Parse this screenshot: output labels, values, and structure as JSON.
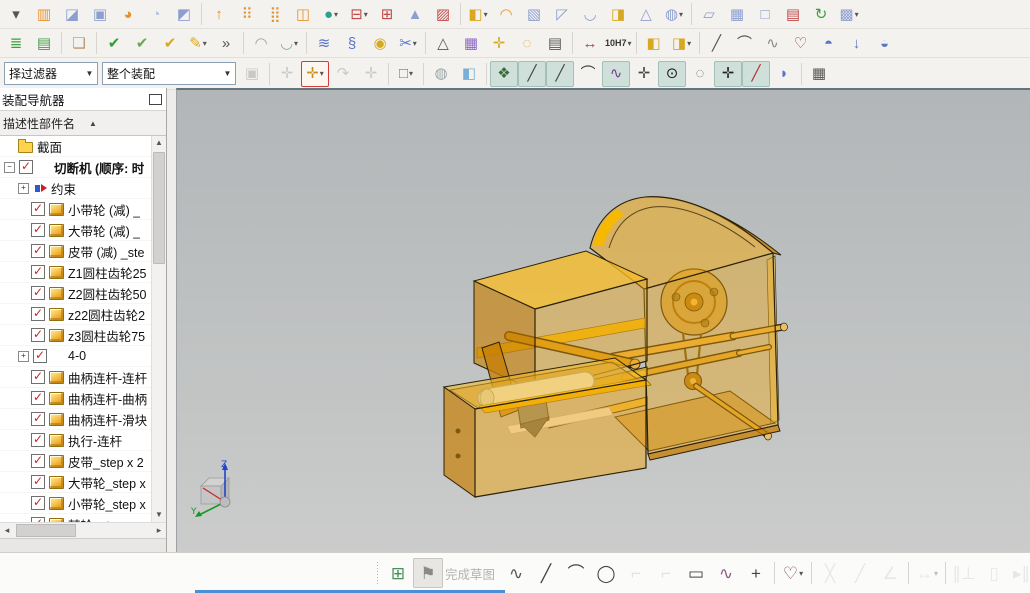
{
  "colors": {
    "check_red": "#cc1f1f",
    "accent_blue": "#4a90d9",
    "viewport_top": "#b2b6b8",
    "viewport_bottom": "#cbcccb",
    "model_edge": "#2c2208",
    "model_bright_yellow": "#f6b900"
  },
  "toolbar_row1": {
    "items": [
      {
        "name": "feature-overflow-icon",
        "glyph": "▾",
        "color": "#555555"
      },
      {
        "name": "split-body-icon",
        "glyph": "▥",
        "color": "#e8922c"
      },
      {
        "name": "trim-body-icon",
        "glyph": "◪",
        "color": "#8d9fd0"
      },
      {
        "name": "hole-icon",
        "glyph": "▣",
        "color": "#8d9fd0"
      },
      {
        "name": "boss-icon",
        "glyph": "◕",
        "color": "#e8922c"
      },
      {
        "name": "groove-icon",
        "glyph": "◔",
        "color": "#b4c0dc"
      },
      {
        "name": "pocket-icon",
        "glyph": "◩",
        "color": "#8d9fd0"
      },
      {
        "sep": true
      },
      {
        "name": "extract-body-icon",
        "glyph": "↑",
        "color": "#e8922c"
      },
      {
        "name": "pattern-feature-icon",
        "glyph": "⠿",
        "color": "#e8922c"
      },
      {
        "name": "pattern-geometry-icon",
        "glyph": "⣿",
        "color": "#e8922c"
      },
      {
        "name": "mirror-feature-icon",
        "glyph": "◫",
        "color": "#e8922c"
      },
      {
        "name": "unite-icon",
        "glyph": "●",
        "color": "#2e9e8f",
        "dd": true
      },
      {
        "name": "subtract-icon",
        "glyph": "⊟",
        "color": "#c04848",
        "dd": true
      },
      {
        "name": "intersect-icon",
        "glyph": "⊞",
        "color": "#c04848"
      },
      {
        "name": "emboss-icon",
        "glyph": "▲",
        "color": "#8d9fd0"
      },
      {
        "name": "offset-face-icon",
        "glyph": "▨",
        "color": "#c04848"
      },
      {
        "sep": true
      },
      {
        "name": "shell-icon",
        "glyph": "◧",
        "color": "#d8a820",
        "dd": true
      },
      {
        "name": "wrap-icon",
        "glyph": "◠",
        "color": "#e8922c"
      },
      {
        "name": "edge-blend-icon",
        "glyph": "▧",
        "color": "#8d9fd0"
      },
      {
        "name": "chamfer-icon",
        "glyph": "◸",
        "color": "#8d9fd0"
      },
      {
        "name": "flange-icon",
        "glyph": "◡",
        "color": "#8d9fd0"
      },
      {
        "name": "draft-icon",
        "glyph": "◨",
        "color": "#d8a820"
      },
      {
        "name": "scale-body-icon",
        "glyph": "△",
        "color": "#8d9fd0"
      },
      {
        "name": "sphere-icon",
        "glyph": "◍",
        "color": "#8d9fd0",
        "dd": true
      },
      {
        "sep": true
      },
      {
        "name": "four-point-surface-icon",
        "glyph": "▱",
        "color": "#8d9fd0"
      },
      {
        "name": "mesh-surface-icon",
        "glyph": "▦",
        "color": "#8d9fd0"
      },
      {
        "name": "bounded-plane-icon",
        "glyph": "□",
        "color": "#8d9fd0"
      },
      {
        "name": "through-curves-icon",
        "glyph": "▤",
        "color": "#c04848"
      },
      {
        "name": "swept-icon",
        "glyph": "↻",
        "color": "#3d9e3d"
      },
      {
        "name": "sew-icon",
        "glyph": "▩",
        "color": "#8d9fd0",
        "dd": true
      }
    ]
  },
  "toolbar_row2": {
    "items": [
      {
        "name": "layer-settings-icon",
        "glyph": "≣",
        "color": "#3d9e3d"
      },
      {
        "name": "layer-category-icon",
        "glyph": "▤",
        "color": "#3d9e3d"
      },
      {
        "sep": true
      },
      {
        "name": "tag-note-icon",
        "glyph": "❏",
        "color": "#b49a6a"
      },
      {
        "sep": true
      },
      {
        "name": "examine-geometry-icon",
        "glyph": "✔",
        "color": "#2da02d"
      },
      {
        "name": "fit-check-icon",
        "glyph": "✔",
        "color": "#6aa84f"
      },
      {
        "name": "check-body-icon",
        "glyph": "✔",
        "color": "#d8a820"
      },
      {
        "name": "edit-object-display-icon",
        "glyph": "✎",
        "color": "#d8a820",
        "dd": true
      },
      {
        "name": "toolbar-overflow-chevron",
        "glyph": "»",
        "color": "#555555"
      },
      {
        "sep": true
      },
      {
        "name": "weld-assistant-icon",
        "glyph": "◠",
        "color": "#98a4a8"
      },
      {
        "name": "weld-groove-icon",
        "glyph": "◡",
        "color": "#98a4a8",
        "dd": true
      },
      {
        "sep": true
      },
      {
        "name": "coil-spring-icon",
        "glyph": "≋",
        "color": "#5a74c8"
      },
      {
        "name": "extension-spring-icon",
        "glyph": "§",
        "color": "#5a74c8"
      },
      {
        "name": "pulley-icon",
        "glyph": "◉",
        "color": "#d8a820"
      },
      {
        "name": "spring-tool-icon",
        "glyph": "✂",
        "color": "#5a74c8",
        "dd": true
      },
      {
        "sep": true
      },
      {
        "name": "triangle-symbol-icon",
        "glyph": "△",
        "color": "#555555"
      },
      {
        "name": "gc-toolbox-table-icon",
        "glyph": "▦",
        "color": "#8a6ac0"
      },
      {
        "name": "point-set-folder-icon",
        "glyph": "✛",
        "color": "#d8a820"
      },
      {
        "name": "circle-set-folder-icon",
        "glyph": "◌",
        "color": "#d8a820"
      },
      {
        "name": "notes-document-icon",
        "glyph": "▤",
        "color": "#555555"
      },
      {
        "sep": true
      },
      {
        "name": "measure-distance-icon",
        "glyph": "↔",
        "color": "#a04848"
      },
      {
        "name": "tolerance-search-icon",
        "label": "10H7",
        "color": "#333333",
        "dd": true
      },
      {
        "sep": true
      },
      {
        "name": "locked-component-icon",
        "glyph": "◧",
        "color": "#d8a820"
      },
      {
        "name": "locked-assembly-icon",
        "glyph": "◨",
        "color": "#d8a820",
        "dd": true
      },
      {
        "sep": true
      },
      {
        "name": "line-curve-icon",
        "glyph": "╱",
        "color": "#555555"
      },
      {
        "name": "arc-curve-icon",
        "glyph": "⌒",
        "color": "#555555"
      },
      {
        "name": "polyline-curve-icon",
        "glyph": "∿",
        "color": "#888888"
      },
      {
        "name": "studio-spline-icon",
        "glyph": "♡",
        "color": "#a03030"
      },
      {
        "name": "section-surface-icon",
        "glyph": "◓",
        "color": "#5a74c8"
      },
      {
        "name": "project-curve-icon",
        "glyph": "↓",
        "color": "#5a74c8"
      },
      {
        "name": "trim-sheet-icon",
        "glyph": "◒",
        "color": "#5a74c8"
      }
    ]
  },
  "selection_bar": {
    "filter_combo": "择过滤器",
    "scope_combo": "整个装配",
    "items": [
      {
        "name": "assembly-search-icon",
        "glyph": "▣",
        "color": "#888888",
        "disabled": true
      },
      {
        "sep": true
      },
      {
        "name": "move-component-icon",
        "glyph": "✛",
        "color": "#888888",
        "disabled": true
      },
      {
        "name": "snap-filter-icon",
        "glyph": "✛",
        "color": "#c79010",
        "redbox": true,
        "dd": true
      },
      {
        "name": "rotate-view-icon",
        "glyph": "↷",
        "color": "#888888",
        "disabled": true
      },
      {
        "name": "show-handles-icon",
        "glyph": "✛",
        "color": "#888888",
        "disabled": true
      },
      {
        "sep": true
      },
      {
        "name": "rectangle-select-icon",
        "glyph": "□",
        "color": "#777777",
        "dashed": true,
        "dd": true
      },
      {
        "sep": true
      },
      {
        "name": "shaded-cylinder-icon",
        "glyph": "◍",
        "color": "#98a4a8"
      },
      {
        "name": "translucent-box-icon",
        "glyph": "◧",
        "color": "#7ab0d8"
      },
      {
        "sep": true
      },
      {
        "name": "snap-point-icon",
        "glyph": "❖",
        "color": "#3a6a3a",
        "on": true
      },
      {
        "name": "snap-endpoint-icon",
        "glyph": "╱",
        "color": "#444444",
        "on": true
      },
      {
        "name": "snap-midpoint-icon",
        "glyph": "╱",
        "color": "#444444",
        "on": true
      },
      {
        "name": "snap-control-point-icon",
        "glyph": "⌒",
        "color": "#444444"
      },
      {
        "name": "snap-node-icon",
        "glyph": "∿",
        "color": "#7a3a8a",
        "on": true
      },
      {
        "name": "snap-quadrant-icon",
        "glyph": "✛",
        "color": "#444444"
      },
      {
        "name": "snap-arc-center-icon",
        "glyph": "⊙",
        "color": "#222222",
        "on": true
      },
      {
        "name": "snap-circle-icon",
        "glyph": "◌",
        "color": "#666666"
      },
      {
        "name": "snap-intersection-icon",
        "glyph": "✛",
        "color": "#222222",
        "on": true
      },
      {
        "name": "snap-point-on-curve-icon",
        "glyph": "╱",
        "color": "#b03030",
        "on": true
      },
      {
        "name": "snap-point-on-face-icon",
        "glyph": "◗",
        "color": "#5a74c8"
      },
      {
        "sep": true
      },
      {
        "name": "grid-icon",
        "glyph": "▦",
        "color": "#555555"
      }
    ]
  },
  "assembly_navigator": {
    "title": "装配导航器",
    "column_header": "描述性部件名",
    "sort_arrow": "▲",
    "tree": [
      {
        "type": "folder",
        "label": "截面",
        "indent": 1
      },
      {
        "type": "assembly",
        "label": "切断机 (顺序: 时",
        "indent": 1,
        "checked": true,
        "expander": "−",
        "bold": true
      },
      {
        "type": "constraint",
        "label": "约束",
        "indent": 2,
        "expander": "+"
      },
      {
        "type": "part",
        "label": "小带轮 (减) _",
        "indent": 2,
        "checked": true
      },
      {
        "type": "part",
        "label": "大带轮 (减) _",
        "indent": 2,
        "checked": true
      },
      {
        "type": "part",
        "label": "皮带 (减) _ste",
        "indent": 2,
        "checked": true
      },
      {
        "type": "part",
        "label": "Z1圆柱齿轮25",
        "indent": 2,
        "checked": true
      },
      {
        "type": "part",
        "label": "Z2圆柱齿轮50",
        "indent": 2,
        "checked": true
      },
      {
        "type": "part",
        "label": "z22圆柱齿轮2",
        "indent": 2,
        "checked": true
      },
      {
        "type": "part",
        "label": "z3圆柱齿轮75",
        "indent": 2,
        "checked": true
      },
      {
        "type": "assembly",
        "label": "4-0",
        "indent": 2,
        "checked": true,
        "expander": "+"
      },
      {
        "type": "part",
        "label": "曲柄连杆-连杆",
        "indent": 2,
        "checked": true
      },
      {
        "type": "part",
        "label": "曲柄连杆-曲柄",
        "indent": 2,
        "checked": true
      },
      {
        "type": "part",
        "label": "曲柄连杆-滑块",
        "indent": 2,
        "checked": true
      },
      {
        "type": "part",
        "label": "执行-连杆",
        "indent": 2,
        "checked": true
      },
      {
        "type": "part",
        "label": "皮带_step x 2",
        "indent": 2,
        "checked": true
      },
      {
        "type": "part",
        "label": "大带轮_step x",
        "indent": 2,
        "checked": true
      },
      {
        "type": "part",
        "label": "小带轮_step x",
        "indent": 2,
        "checked": true
      },
      {
        "type": "part",
        "label": "棘轮_step",
        "indent": 2,
        "checked": true
      }
    ]
  },
  "viewport": {
    "model_name": "切断机",
    "triad": {
      "z": "Z",
      "y": "Y"
    }
  },
  "sketch_toolbar": {
    "items": [
      {
        "handle": true
      },
      {
        "name": "sketch-task-icon",
        "glyph": "⊞",
        "color": "#4a8f5a"
      },
      {
        "name": "finish-sketch-flag-icon",
        "glyph": "⚑",
        "color": "#8a8a8a",
        "boxed": true
      },
      {
        "name": "finish-sketch-label",
        "text": "完成草图"
      },
      {
        "name": "profile-icon",
        "glyph": "∿",
        "color": "#555555"
      },
      {
        "name": "sketch-line-icon",
        "glyph": "╱",
        "color": "#444444"
      },
      {
        "name": "sketch-arc-icon",
        "glyph": "⌒",
        "color": "#444444"
      },
      {
        "name": "sketch-circle-icon",
        "glyph": "◯",
        "color": "#444444"
      },
      {
        "name": "fillet-icon",
        "glyph": "⌐",
        "color": "#bbbbbb",
        "disabled": true
      },
      {
        "name": "chamfer-corner-icon",
        "glyph": "⌐",
        "color": "#bbbbbb",
        "disabled": true
      },
      {
        "name": "rectangle-icon",
        "glyph": "▭",
        "color": "#444444"
      },
      {
        "name": "polygon-spline-icon",
        "glyph": "∿",
        "color": "#8a5a8a"
      },
      {
        "name": "point-icon",
        "glyph": "+",
        "color": "#444444"
      },
      {
        "sep": true
      },
      {
        "name": "offset-curve-icon",
        "glyph": "♡",
        "color": "#7a4a4a",
        "dd": true
      },
      {
        "sep": true
      },
      {
        "name": "quick-trim-icon",
        "glyph": "╳",
        "color": "#c9c9c9",
        "disabled": true
      },
      {
        "name": "quick-extend-icon",
        "glyph": "╱",
        "color": "#c9c9c9",
        "disabled": true
      },
      {
        "name": "make-corner-icon",
        "glyph": "∠",
        "color": "#c9c9c9",
        "disabled": true
      },
      {
        "sep": true
      },
      {
        "name": "rapid-dimension-icon",
        "glyph": "↔",
        "color": "#c9c9c9",
        "disabled": true,
        "dd": true
      },
      {
        "sep": true
      },
      {
        "name": "geometric-constraints-icon",
        "glyph": "∥⊥",
        "color": "#c9c9c9",
        "disabled": true
      },
      {
        "name": "make-symmetric-icon",
        "glyph": "▯",
        "color": "#c9c9c9",
        "disabled": true
      },
      {
        "name": "display-constraints-icon",
        "glyph": "▸∥",
        "color": "#c9c9c9",
        "disabled": true,
        "dd": true
      },
      {
        "sep": true
      },
      {
        "name": "sketch-preferences-icon",
        "glyph": "▧",
        "color": "#6a8ab8"
      },
      {
        "name": "reattach-icon",
        "glyph": "↻",
        "color": "#b07030"
      }
    ]
  }
}
